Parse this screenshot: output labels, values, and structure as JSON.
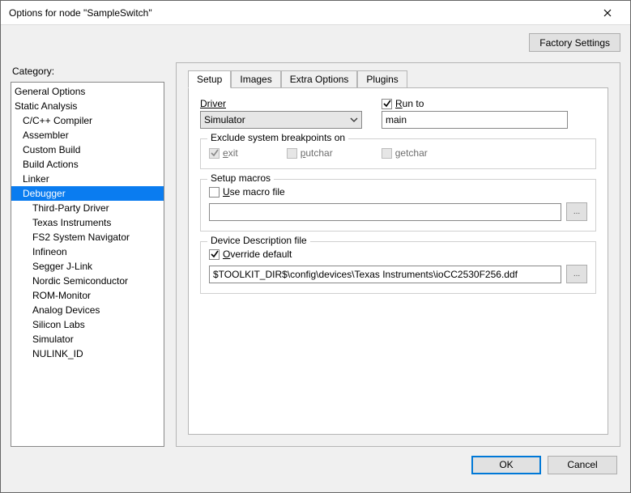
{
  "window": {
    "title": "Options for node \"SampleSwitch\""
  },
  "category_label": "Category:",
  "tree": [
    {
      "label": "General Options",
      "depth": 0
    },
    {
      "label": "Static Analysis",
      "depth": 0
    },
    {
      "label": "C/C++ Compiler",
      "depth": 1
    },
    {
      "label": "Assembler",
      "depth": 1
    },
    {
      "label": "Custom Build",
      "depth": 1
    },
    {
      "label": "Build Actions",
      "depth": 1
    },
    {
      "label": "Linker",
      "depth": 1
    },
    {
      "label": "Debugger",
      "depth": 1,
      "selected": true
    },
    {
      "label": "Third-Party Driver",
      "depth": 2
    },
    {
      "label": "Texas Instruments",
      "depth": 2
    },
    {
      "label": "FS2 System Navigator",
      "depth": 2
    },
    {
      "label": "Infineon",
      "depth": 2
    },
    {
      "label": "Segger J-Link",
      "depth": 2
    },
    {
      "label": "Nordic Semiconductor",
      "depth": 2
    },
    {
      "label": "ROM-Monitor",
      "depth": 2
    },
    {
      "label": "Analog Devices",
      "depth": 2
    },
    {
      "label": "Silicon Labs",
      "depth": 2
    },
    {
      "label": "Simulator",
      "depth": 2
    },
    {
      "label": "NULINK_ID",
      "depth": 2
    }
  ],
  "buttons": {
    "factory_settings": "Factory Settings",
    "ok": "OK",
    "cancel": "Cancel"
  },
  "tabs": [
    "Setup",
    "Images",
    "Extra Options",
    "Plugins"
  ],
  "active_tab": 0,
  "setup": {
    "driver_label": "Driver",
    "driver_value": "Simulator",
    "run_to_label": "Run to",
    "run_to_checked": true,
    "run_to_value": "main",
    "exclude_label": "Exclude system breakpoints on",
    "exclude_opts": {
      "exit": {
        "label": "exit",
        "checked": true,
        "enabled": false
      },
      "putchar": {
        "label": "putchar",
        "checked": false,
        "enabled": false
      },
      "getchar": {
        "label": "getchar",
        "checked": false,
        "enabled": false
      }
    },
    "macros_label": "Setup macros",
    "use_macro_label": "Use macro file",
    "use_macro_checked": false,
    "macro_path": "",
    "ddf_label": "Device Description file",
    "override_label": "Override default",
    "override_checked": true,
    "ddf_path": "$TOOLKIT_DIR$\\config\\devices\\Texas Instruments\\ioCC2530F256.ddf"
  }
}
